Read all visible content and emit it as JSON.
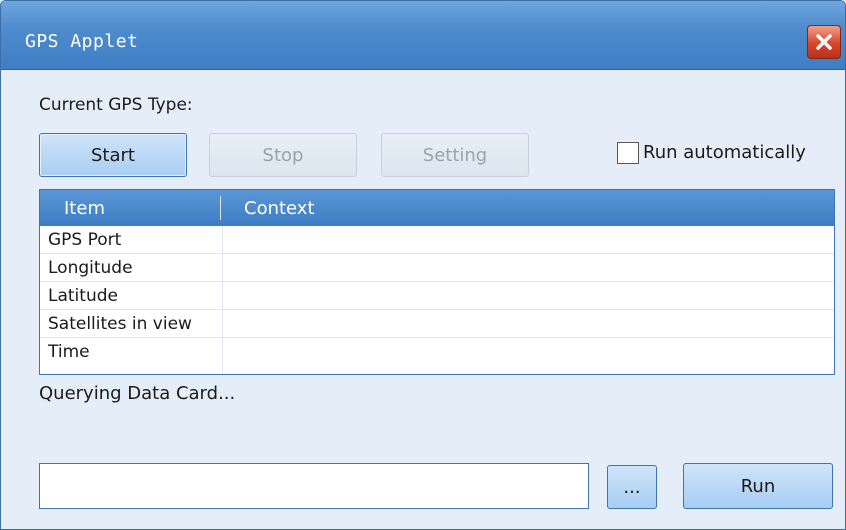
{
  "window": {
    "title": "GPS Applet",
    "close_icon": "close-icon",
    "accent_color": "#4f8ccd",
    "close_color": "#d9452a"
  },
  "gps": {
    "type_label": "Current GPS Type:"
  },
  "buttons": {
    "start": "Start",
    "stop": "Stop",
    "setting": "Setting"
  },
  "run_automatically": {
    "label": "Run automatically",
    "checked": false
  },
  "table": {
    "headers": [
      "Item",
      "Context"
    ],
    "rows": [
      {
        "item": "GPS Port",
        "context": ""
      },
      {
        "item": "Longitude",
        "context": ""
      },
      {
        "item": "Latitude",
        "context": ""
      },
      {
        "item": "Satellites in view",
        "context": ""
      },
      {
        "item": "Time",
        "context": ""
      }
    ]
  },
  "status": {
    "text": "Querying Data Card..."
  },
  "command": {
    "input_value": "",
    "browse_label": "...",
    "run_label": "Run"
  }
}
